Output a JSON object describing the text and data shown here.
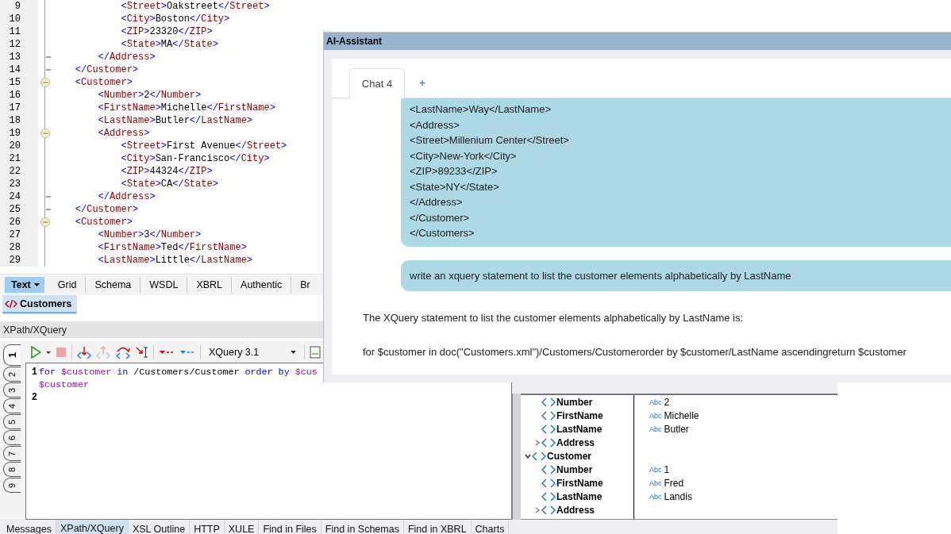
{
  "xml_editor": {
    "lines": [
      {
        "number": "9",
        "code": "            <Street>Oakstreet</Street>"
      },
      {
        "number": "10",
        "code": "            <City>Boston</City>"
      },
      {
        "number": "11",
        "code": "            <ZIP>23320</ZIP>"
      },
      {
        "number": "12",
        "code": "            <State>MA</State>"
      },
      {
        "number": "13",
        "code": "        </Address>",
        "kind": "fold_end"
      },
      {
        "number": "14",
        "code": "    </Customer>",
        "kind": "fold_end"
      },
      {
        "number": "15",
        "code": "    <Customer>",
        "kind": "fold_start"
      },
      {
        "number": "16",
        "code": "        <Number>2</Number>"
      },
      {
        "number": "17",
        "code": "        <FirstName>Michelle</FirstName>"
      },
      {
        "number": "18",
        "code": "        <LastName>Butler</LastName>"
      },
      {
        "number": "19",
        "code": "        <Address>",
        "kind": "fold_start"
      },
      {
        "number": "20",
        "code": "            <Street>First Avenue</Street>"
      },
      {
        "number": "21",
        "code": "            <City>San-Francisco</City>"
      },
      {
        "number": "22",
        "code": "            <ZIP>44324</ZIP>"
      },
      {
        "number": "23",
        "code": "            <State>CA</State>"
      },
      {
        "number": "24",
        "code": "        </Address>",
        "kind": "fold_end"
      },
      {
        "number": "25",
        "code": "    </Customer>",
        "kind": "fold_end"
      },
      {
        "number": "26",
        "code": "    <Customer>",
        "kind": "fold_start"
      },
      {
        "number": "27",
        "code": "        <Number>3</Number>"
      },
      {
        "number": "28",
        "code": "        <FirstName>Ted</FirstName>"
      },
      {
        "number": "29",
        "code": "        <LastName>Little</LastName>"
      }
    ]
  },
  "view_tabs": [
    {
      "label": "Text",
      "selected": true
    },
    {
      "label": "Grid",
      "selected": false
    },
    {
      "label": "Schema",
      "selected": false
    },
    {
      "label": "WSDL",
      "selected": false
    },
    {
      "label": "XBRL",
      "selected": false
    },
    {
      "label": "Authentic",
      "selected": false
    },
    {
      "label": "Br",
      "selected": false
    }
  ],
  "document_tabs": [
    {
      "label": "Customers",
      "selected": true
    }
  ],
  "xpath_panel": {
    "title": "XPath/XQuery",
    "language": "XQuery 3.1",
    "query_tabs": [
      {
        "label": "1",
        "selected": true
      },
      {
        "label": "2",
        "selected": false
      },
      {
        "label": "3",
        "selected": false
      },
      {
        "label": "4",
        "selected": false
      },
      {
        "label": "5",
        "selected": false
      },
      {
        "label": "6",
        "selected": false
      },
      {
        "label": "7",
        "selected": false
      },
      {
        "label": "8",
        "selected": false
      },
      {
        "label": "9",
        "selected": false
      }
    ],
    "query_lines": [
      {
        "number": "1",
        "tokens": [
          {
            "text": "for ",
            "kind": "keyword"
          },
          {
            "text": "$customer ",
            "kind": "variable"
          },
          {
            "text": "in ",
            "kind": "keyword"
          },
          {
            "text": "/Customers/Customer ",
            "kind": "path"
          },
          {
            "text": "order by ",
            "kind": "keyword"
          },
          {
            "text": "$cus",
            "kind": "variable"
          }
        ]
      },
      {
        "tokens": [
          {
            "text": "$customer",
            "kind": "variable"
          }
        ]
      },
      {
        "number": "2"
      }
    ]
  },
  "result_tree": {
    "items": [
      {
        "children": [
          {
            "name": "Number",
            "type": "Abc",
            "value": "2"
          },
          {
            "name": "FirstName",
            "type": "Abc",
            "value": "Michelle"
          },
          {
            "name": "LastName",
            "type": "Abc",
            "value": "Butler"
          },
          {
            "name": "Address",
            "expanded": false
          }
        ]
      },
      {
        "name": "Customer",
        "expanded": true,
        "children": [
          {
            "name": "Number",
            "type": "Abc",
            "value": "1"
          },
          {
            "name": "FirstName",
            "type": "Abc",
            "value": "Fred"
          },
          {
            "name": "LastName",
            "type": "Abc",
            "value": "Landis"
          },
          {
            "name": "Address",
            "expanded": false
          }
        ]
      }
    ]
  },
  "bottom_tabs": [
    {
      "label": "Messages",
      "selected": false
    },
    {
      "label": "XPath/XQuery",
      "selected": true
    },
    {
      "label": "XSL Outline",
      "selected": false
    },
    {
      "label": "HTTP",
      "selected": false
    },
    {
      "label": "XULE",
      "selected": false
    },
    {
      "label": "Find in Files",
      "selected": false
    },
    {
      "label": "Find in Schemas",
      "selected": false
    },
    {
      "label": "Find in XBRL",
      "selected": false
    },
    {
      "label": "Charts",
      "selected": false
    }
  ],
  "ai_assistant": {
    "title": "AI-Assistant",
    "chat_tabs": [
      {
        "label": "Chat 4",
        "selected": true
      }
    ],
    "new_tab_label": "+",
    "messages": [
      {
        "kind": "user",
        "lines": [
          "<LastName>Way</LastName>",
          "<Address>",
          "<Street>Millenium Center</Street>",
          "<City>New-York</City>",
          "<ZIP>89233</ZIP>",
          "<State>NY</State>",
          "</Address>",
          "</Customer>",
          "</Customers>"
        ]
      },
      {
        "kind": "user",
        "lines": [
          "write an xquery statement to list the customer elements alphabetically by LastName"
        ]
      },
      {
        "kind": "assistant",
        "lines": [
          "The XQuery statement to list the customer elements alphabetically by LastName is:",
          "for $customer in doc(\"Customers.xml\")/Customers/Customerorder by $customer/LastName ascendingreturn $customer"
        ]
      }
    ]
  }
}
